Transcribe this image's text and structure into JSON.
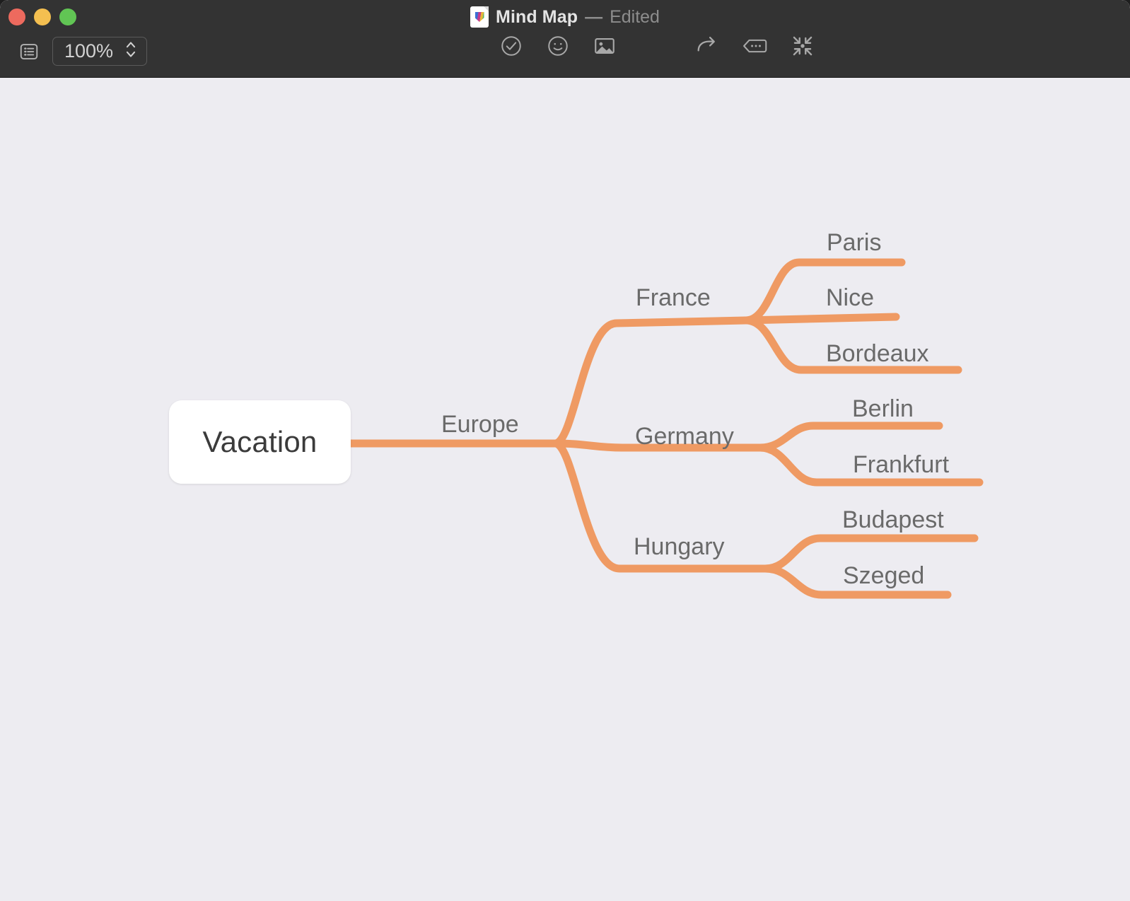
{
  "window": {
    "traffic_lights": [
      {
        "name": "close",
        "color": "#ed6a5e"
      },
      {
        "name": "minimize",
        "color": "#f4bf50"
      },
      {
        "name": "maximize",
        "color": "#61c554"
      }
    ],
    "title": "Mind Map",
    "title_separator": "—",
    "title_status": "Edited",
    "document_icon": "mindnode-document-icon"
  },
  "toolbar": {
    "sidebar_toggle_icon": "outline-list-icon",
    "zoom_value": "100%",
    "zoom_stepper_icon": "stepper-updown-icon",
    "items": [
      {
        "icon": "checkmark-circle-icon",
        "label": "Task"
      },
      {
        "icon": "smiley-face-icon",
        "label": "Sticker"
      },
      {
        "icon": "image-icon",
        "label": "Image"
      },
      {
        "icon": "redo-arrow-icon",
        "label": "Redo"
      },
      {
        "icon": "note-bubble-icon",
        "label": "Note"
      },
      {
        "icon": "collapse-focus-icon",
        "label": "Focus"
      }
    ]
  },
  "canvas": {
    "background_color": "#edecf1",
    "branch_color": "#ef9a63",
    "node_text_color": "#6a6a6a",
    "root_text_color": "#3b3b3b",
    "root_fill": "#ffffff"
  },
  "mindmap": {
    "root": "Vacation",
    "branches": [
      {
        "label": "Europe",
        "children": [
          {
            "label": "France",
            "children": [
              {
                "label": "Paris"
              },
              {
                "label": "Nice"
              },
              {
                "label": "Bordeaux"
              }
            ]
          },
          {
            "label": "Germany",
            "children": [
              {
                "label": "Berlin"
              },
              {
                "label": "Frankfurt"
              }
            ]
          },
          {
            "label": "Hungary",
            "children": [
              {
                "label": "Budapest"
              },
              {
                "label": "Szeged"
              }
            ]
          }
        ]
      }
    ]
  },
  "labels": {
    "europe": "Europe",
    "france": "France",
    "germany": "Germany",
    "hungary": "Hungary",
    "paris": "Paris",
    "nice": "Nice",
    "bordeaux": "Bordeaux",
    "berlin": "Berlin",
    "frankfurt": "Frankfurt",
    "budapest": "Budapest",
    "szeged": "Szeged",
    "root": "Vacation"
  }
}
